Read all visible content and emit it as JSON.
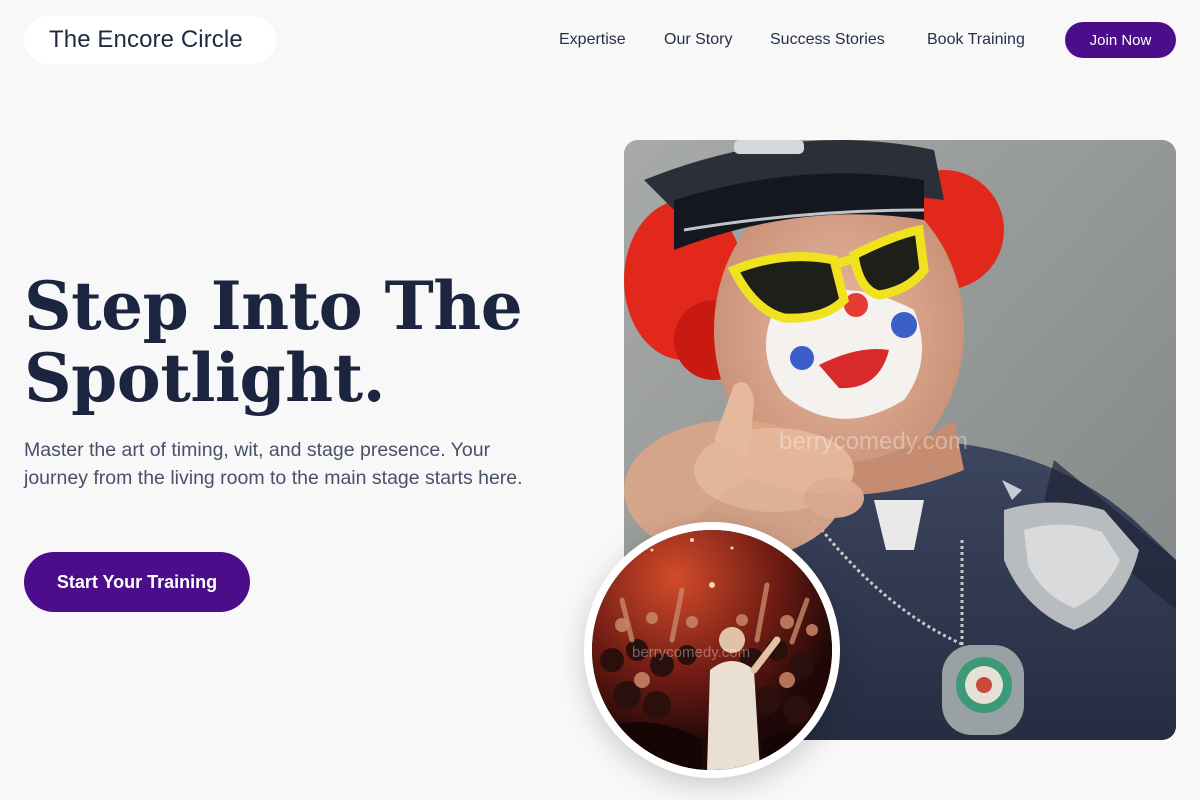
{
  "header": {
    "logo_text": "The Encore Circle",
    "nav": [
      {
        "label": "Expertise"
      },
      {
        "label": "Our Story"
      },
      {
        "label": "Success Stories"
      },
      {
        "label": "Book Training"
      }
    ],
    "join_label": "Join Now"
  },
  "hero": {
    "title": "Step Into The Spotlight.",
    "subtitle": "Master the art of timing, wit, and stage presence. Your journey from the living room to the main stage starts here.",
    "cta_label": "Start Your Training"
  },
  "images": {
    "main_watermark": "berrycomedy.com",
    "circle_watermark": "berrycomedy.com"
  },
  "colors": {
    "brand": "#4c0d8a",
    "background": "#f8f8f9",
    "heading": "#1b2540"
  }
}
